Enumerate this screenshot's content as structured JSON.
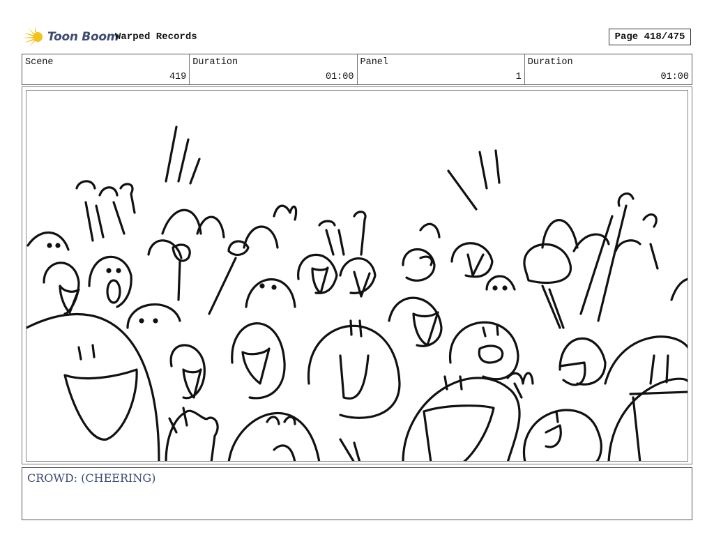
{
  "header": {
    "logo_text": "Toon Boom",
    "logo_icon": "sunburst-logo-icon",
    "logo_color": "#f2c31a",
    "project_title": "Warped Records",
    "page_indicator": "Page 418/475"
  },
  "info_bar": [
    {
      "label": "Scene",
      "value": "419"
    },
    {
      "label": "Duration",
      "value": "01:00"
    },
    {
      "label": "Panel",
      "value": "1"
    },
    {
      "label": "Duration",
      "value": "01:00"
    }
  ],
  "panel": {
    "image_kind": "storyboard-sketch",
    "content": "crowd-cheering-sketch"
  },
  "notes": {
    "dialogue": "CROWD: (CHEERING)",
    "text_color": "#3b4a78"
  }
}
